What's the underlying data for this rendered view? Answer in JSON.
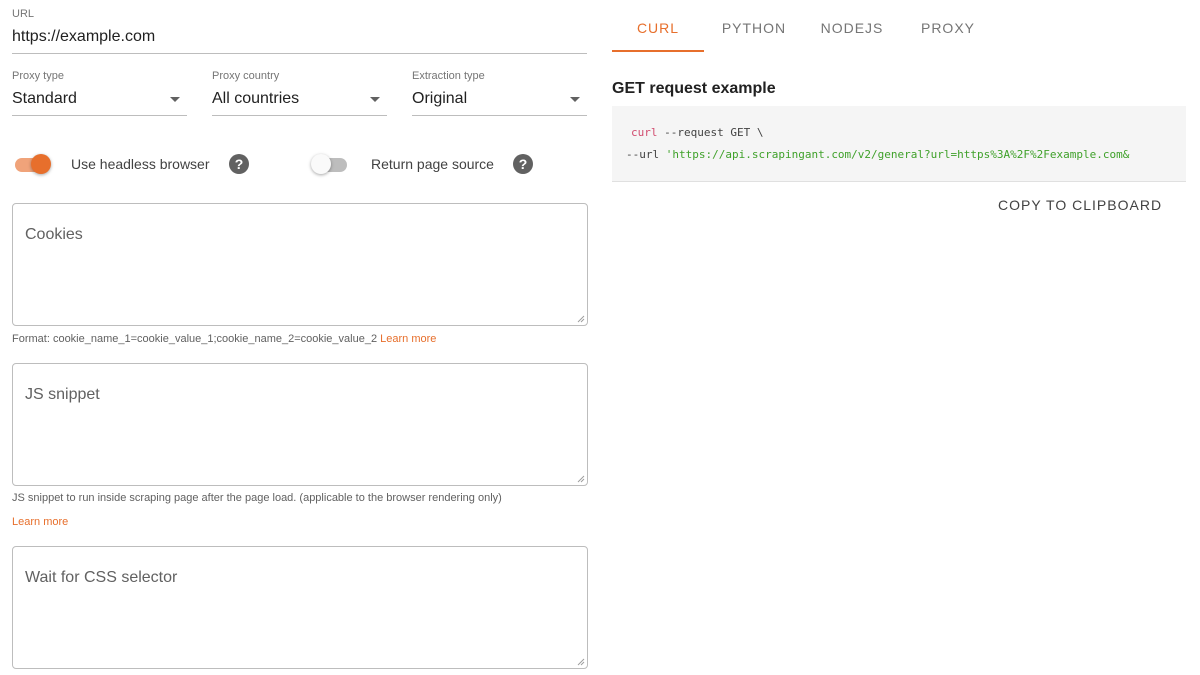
{
  "form": {
    "url": {
      "label": "URL",
      "value": "https://example.com"
    },
    "proxy_type": {
      "label": "Proxy type",
      "value": "Standard"
    },
    "proxy_country": {
      "label": "Proxy country",
      "value": "All countries"
    },
    "extraction_type": {
      "label": "Extraction type",
      "value": "Original"
    },
    "headless": {
      "label": "Use headless browser",
      "on": true,
      "help": "?"
    },
    "page_source": {
      "label": "Return page source",
      "on": false,
      "help": "?"
    },
    "cookies": {
      "placeholder": "Cookies",
      "helper": "Format: cookie_name_1=cookie_value_1;cookie_name_2=cookie_value_2",
      "link": "Learn more"
    },
    "js_snippet": {
      "placeholder": "JS snippet",
      "helper": "JS snippet to run inside scraping page after the page load. (applicable to the browser rendering only)",
      "link": "Learn more"
    },
    "css_selector": {
      "placeholder": "Wait for CSS selector"
    }
  },
  "tabs": [
    {
      "label": "CURL",
      "active": true
    },
    {
      "label": "PYTHON",
      "active": false
    },
    {
      "label": "NODEJS",
      "active": false
    },
    {
      "label": "PROXY",
      "active": false
    }
  ],
  "example": {
    "title": "GET request example",
    "line1_cmd": "curl",
    "line1_rest": " --request GET \\",
    "line2_flag": "--url ",
    "line2_str": "'https://api.scrapingant.com/v2/general?url=https%3A%2F%2Fexample.com&",
    "copy_label": "COPY TO CLIPBOARD"
  },
  "colors": {
    "accent": "#e76f2c",
    "code_keyword": "#d14c6f",
    "code_string": "#3fa12a"
  }
}
